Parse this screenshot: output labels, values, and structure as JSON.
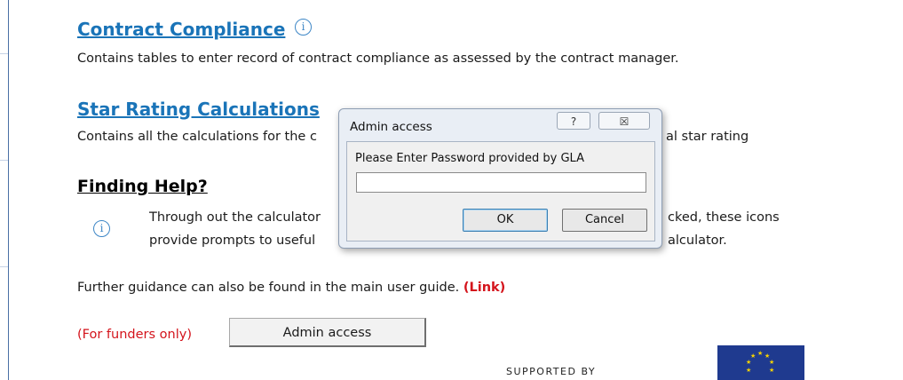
{
  "sections": {
    "contract_title": "Contract Compliance",
    "contract_desc": "Contains tables to enter record of contract compliance as assessed by the contract manager.",
    "star_title": "Star Rating Calculations",
    "star_desc_left": "Contains all the calculations for the c",
    "star_desc_right": "al star rating",
    "help_title": "Finding Help?",
    "help_line1_left": "Through out the calculator",
    "help_line1_right": "cked, these icons",
    "help_line2_left": "provide prompts to useful",
    "help_line2_right": "alculator.",
    "further_text": "Further guidance can also be found in the main user guide.",
    "link_text": "(Link)",
    "funders_text": "(For funders only)",
    "admin_button": "Admin access",
    "supported_by": "SUPPORTED BY",
    "info_glyph": "i"
  },
  "dialog": {
    "title": "Admin access",
    "help_btn": "?",
    "close_btn": "☒",
    "prompt": "Please Enter Password provided by GLA",
    "password_value": "",
    "ok_label": "OK",
    "cancel_label": "Cancel"
  },
  "colors": {
    "link_blue": "#1a74b8",
    "red": "#d4141c",
    "eu_blue": "#1f3a8f",
    "eu_gold": "#f6d200"
  },
  "icons": [
    "info-icon",
    "help-icon",
    "close-icon",
    "eu-flag-icon"
  ]
}
